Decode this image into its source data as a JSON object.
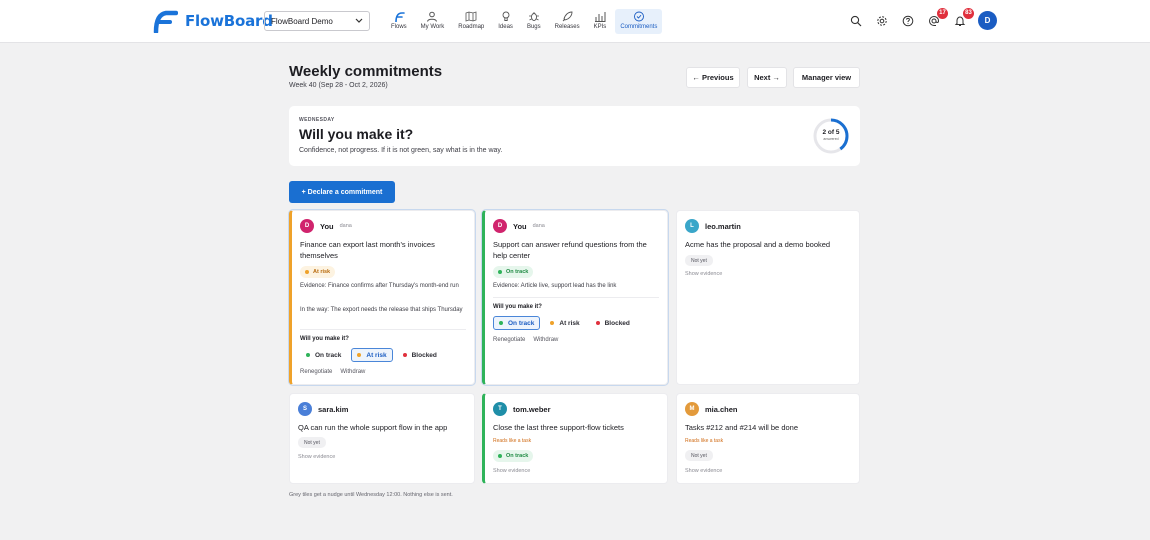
{
  "app": {
    "name": "FlowBoard",
    "workspace": "FlowBoard Demo",
    "nav": [
      {
        "label": "Flows",
        "icon": "flows-icon",
        "active": false
      },
      {
        "label": "My Work",
        "icon": "person-icon",
        "active": false
      },
      {
        "label": "Roadmap",
        "icon": "map-icon",
        "active": false
      },
      {
        "label": "Ideas",
        "icon": "lightbulb-icon",
        "active": false
      },
      {
        "label": "Bugs",
        "icon": "bug-icon",
        "active": false
      },
      {
        "label": "Releases",
        "icon": "rocket-icon",
        "active": false
      },
      {
        "label": "KPIs",
        "icon": "bar-chart-icon",
        "active": false
      },
      {
        "label": "Commitments",
        "icon": "check-circle-icon",
        "active": true
      }
    ],
    "header_icons": {
      "mentions_badge": "17",
      "notifications_badge": "83",
      "user_initial": "D"
    },
    "colors": {
      "brand": "#1a73d9",
      "accent": "#1a6fd1",
      "at_risk": "#efa22a",
      "on_track": "#2fb35a",
      "blocked": "#e0303d"
    }
  },
  "page": {
    "title": "Weekly commitments",
    "subtitle": "Week 40 (Sep 28 - Oct 2, 2026)",
    "buttons": {
      "previous": "← Previous",
      "next": "Next →",
      "manager": "Manager view"
    }
  },
  "prompt": {
    "day": "WEDNESDAY",
    "question": "Will you make it?",
    "hint": "Confidence, not progress. If it is not green, say what is in the way.",
    "progress_text": "2 of 5",
    "progress_label": "answered",
    "answered": 2,
    "total": 5
  },
  "declare_button": "+ Declare a commitment",
  "labels": {
    "will_you": "Will you make it?",
    "on_track": "On track",
    "at_risk": "At risk",
    "blocked": "Blocked",
    "renegotiate": "Renegotiate",
    "withdraw": "Withdraw",
    "not_yet": "Not yet",
    "show_evidence": "Show evidence",
    "reads_like_task": "Reads like a task"
  },
  "cards": [
    {
      "name": "You",
      "handle": "dana",
      "initial": "D",
      "avatar_color": "#d0246d",
      "text": "Finance can export last month's invoices themselves",
      "status": "At risk",
      "evidence": "Evidence: Finance confirms after Thursday's month-end run",
      "in_the_way": "In the way: The export needs the release that ships Thursday"
    },
    {
      "name": "You",
      "handle": "dana",
      "initial": "D",
      "avatar_color": "#d0246d",
      "text": "Support can answer refund questions from the help center",
      "status": "On track",
      "evidence": "Evidence: Article live, support lead has the link"
    },
    {
      "name": "leo.martin",
      "initial": "L",
      "avatar_color": "#3aa6c9",
      "text": "Acme has the proposal and a demo booked"
    },
    {
      "name": "sara.kim",
      "initial": "S",
      "avatar_color": "#4a7fd8",
      "text": "QA can run the whole support flow in the app"
    },
    {
      "name": "tom.weber",
      "initial": "T",
      "avatar_color": "#1f8ea8",
      "text": "Close the last three support-flow tickets",
      "status": "On track"
    },
    {
      "name": "mia.chen",
      "initial": "M",
      "avatar_color": "#e39a3b",
      "text": "Tasks #212 and #214 will be done"
    }
  ],
  "footnote": "Grey tiles get a nudge until Wednesday 12:00. Nothing else is sent."
}
